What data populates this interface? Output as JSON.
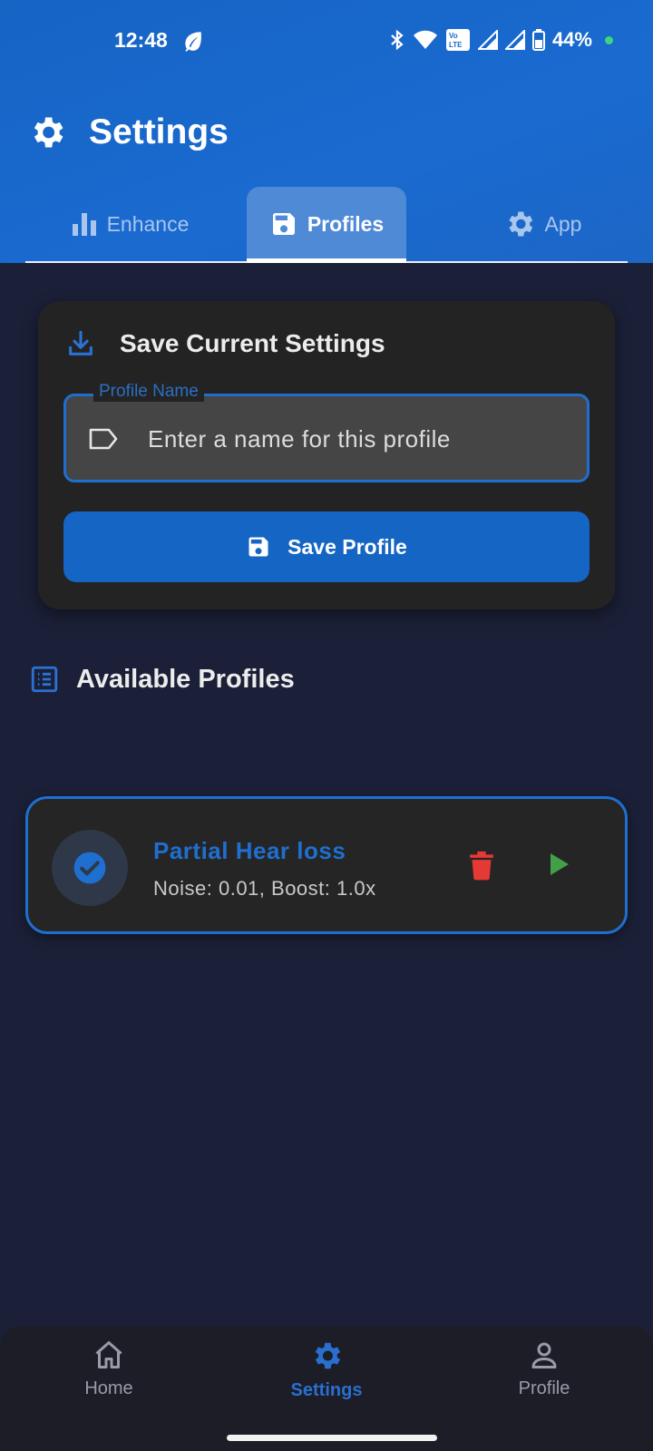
{
  "status_bar": {
    "time": "12:48",
    "battery_percent": "44%",
    "lte_label": "Vo LTE",
    "icons": [
      "leaf-icon",
      "bluetooth-icon",
      "wifi-icon",
      "volte-icon",
      "signal-icon",
      "signal-icon",
      "battery-icon"
    ]
  },
  "header": {
    "title": "Settings",
    "title_icon": "gear-icon"
  },
  "tabs": [
    {
      "label": "Enhance",
      "icon": "bar-chart-icon",
      "active": false
    },
    {
      "label": "Profiles",
      "icon": "floppy-disk-icon",
      "active": true
    },
    {
      "label": "App",
      "icon": "gear-icon",
      "active": false
    }
  ],
  "save_card": {
    "title": "Save Current Settings",
    "title_icon": "download-icon",
    "input_label": "Profile Name",
    "input_placeholder": "Enter a name for this profile",
    "input_value": "",
    "input_icon": "tag-icon",
    "save_button_label": "Save Profile",
    "save_button_icon": "floppy-disk-icon"
  },
  "profiles_section": {
    "title": "Available Profiles",
    "title_icon": "list-icon",
    "items": [
      {
        "name": "Partial Hear loss",
        "detail": "Noise: 0.01, Boost: 1.0x",
        "selected": true,
        "actions": [
          "trash-icon",
          "play-icon"
        ]
      }
    ]
  },
  "bottom_nav": {
    "items": [
      {
        "label": "Home",
        "icon": "home-icon",
        "active": false
      },
      {
        "label": "Settings",
        "icon": "gear-icon",
        "active": true
      },
      {
        "label": "Profile",
        "icon": "person-icon",
        "active": false
      }
    ]
  },
  "colors": {
    "header_blue": "#1a66c8",
    "background": "#1b2038",
    "card": "#232323",
    "accent": "#1f6fd0",
    "delete_red": "#e53935",
    "play_green": "#43a047"
  }
}
